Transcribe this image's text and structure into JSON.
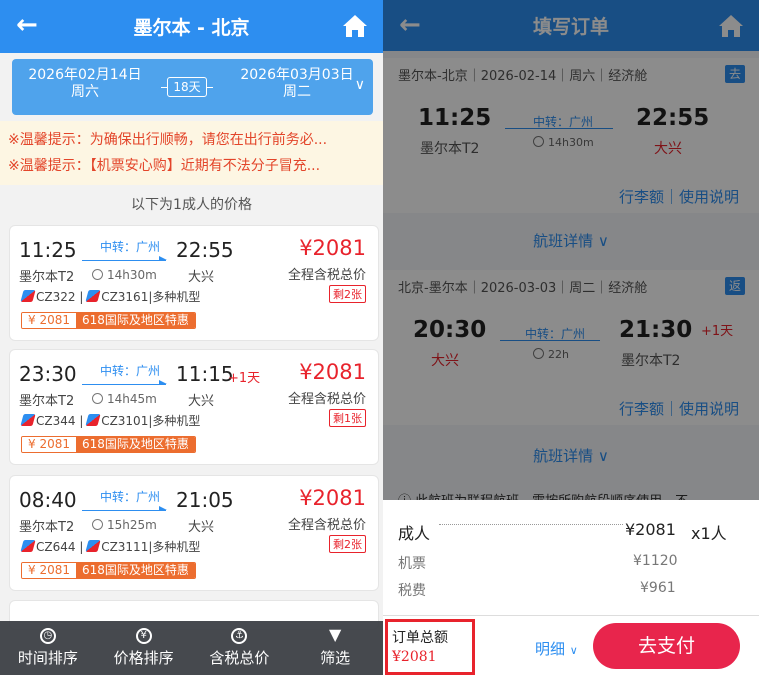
{
  "left": {
    "title": "墨尔本 - 北京",
    "depart_date": "2026年02月14日 周六",
    "return_date": "2026年03月03日 周二",
    "nights": "18天",
    "notices": [
      "※温馨提示：为确保出行顺畅，请您在出行前务必...",
      "※温馨提示：【机票安心购】近期有不法分子冒充..."
    ],
    "price_hint": "以下为1成人的价格",
    "flights": [
      {
        "dep": "11:25",
        "arr": "22:55",
        "via": "中转：广州",
        "dep_ap": "墨尔本T2",
        "arr_ap": "大兴",
        "dur": "14h30m",
        "plus": "",
        "price": "¥2081",
        "total": "全程含税总价",
        "remain": "剩2张",
        "codes": [
          "CZ322",
          "CZ3161"
        ],
        "aircraft": "|多种机型",
        "tag_price": "¥ 2081",
        "tag_text": "618国际及地区特惠"
      },
      {
        "dep": "23:30",
        "arr": "11:15",
        "via": "中转：广州",
        "dep_ap": "墨尔本T2",
        "arr_ap": "大兴",
        "dur": "14h45m",
        "plus": "+1天",
        "price": "¥2081",
        "total": "全程含税总价",
        "remain": "剩1张",
        "codes": [
          "CZ344",
          "CZ3101"
        ],
        "aircraft": "|多种机型",
        "tag_price": "¥ 2081",
        "tag_text": "618国际及地区特惠"
      },
      {
        "dep": "08:40",
        "arr": "21:05",
        "via": "中转：广州",
        "dep_ap": "墨尔本T2",
        "arr_ap": "大兴",
        "dur": "15h25m",
        "plus": "",
        "price": "¥2081",
        "total": "全程含税总价",
        "remain": "剩2张",
        "codes": [
          "CZ644",
          "CZ3111"
        ],
        "aircraft": "|多种机型",
        "tag_price": "¥ 2081",
        "tag_text": "618国际及地区特惠"
      }
    ],
    "nav": [
      {
        "label": "时间排序",
        "icon": "clock-icon"
      },
      {
        "label": "价格排序",
        "icon": "yen-icon"
      },
      {
        "label": "含税总价",
        "icon": "anchor-icon"
      },
      {
        "label": "筛选",
        "icon": "filter-icon"
      }
    ]
  },
  "right": {
    "title": "填写订单",
    "out": {
      "header": "墨尔本-北京｜2026-02-14｜周六｜经济舱",
      "badge": "去",
      "dep": "11:25",
      "arr": "22:55",
      "via": "中转：广州",
      "dur": "14h30m",
      "dep_ap": "墨尔本T2",
      "arr_ap": "大兴",
      "plus": ""
    },
    "ret": {
      "header": "北京-墨尔本｜2026-03-03｜周二｜经济舱",
      "badge": "返",
      "dep": "20:30",
      "arr": "21:30",
      "via": "中转：广州",
      "dur": "22h",
      "dep_ap": "大兴",
      "arr_ap": "墨尔本T2",
      "plus": "+1天"
    },
    "links": "行李额｜使用说明",
    "details": "航班详情",
    "notice": "此航班为联程航班，需按所购航段顺序使用，不",
    "breakdown": {
      "adult_label": "成人",
      "adult_price": "¥2081",
      "adult_qty": "x1人",
      "ticket_label": "机票",
      "ticket_price": "¥1120",
      "tax_label": "税费",
      "tax_price": "¥961"
    },
    "footer": {
      "total_label": "订单总额",
      "total": "¥2081",
      "detail": "明细",
      "pay": "去支付"
    }
  }
}
